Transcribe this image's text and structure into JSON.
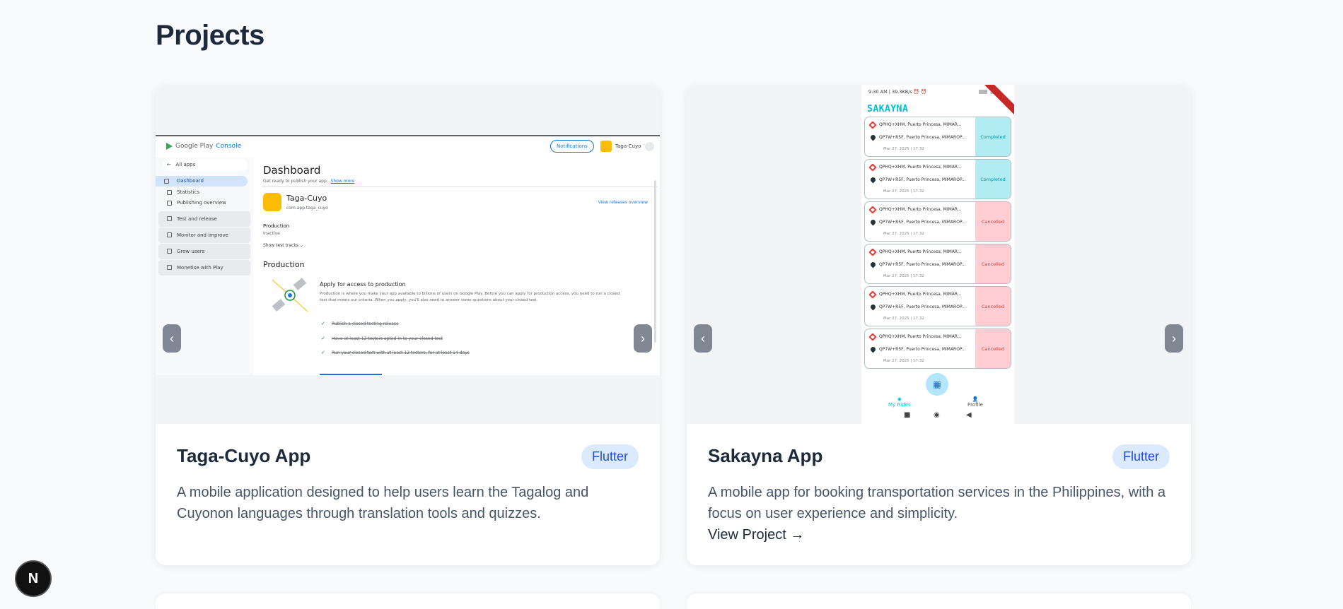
{
  "page": {
    "title": "Projects"
  },
  "projects": [
    {
      "title": "Taga-Cuyo App",
      "tag": "Flutter",
      "description": "A mobile application designed to help users learn the Tagalog and Cuyonon languages through translation tools and quizzes.",
      "prev": "‹",
      "next": "›",
      "screenshot": {
        "brand": "Google Play",
        "brand_suffix": "Console",
        "notifications": "Notifications",
        "user": "Taga-Cuyo",
        "all_apps": "All apps",
        "nav": [
          "Dashboard",
          "Statistics",
          "Publishing overview"
        ],
        "nav_groups": [
          "Test and release",
          "Monitor and improve",
          "Grow users",
          "Monetise with Play"
        ],
        "heading": "Dashboard",
        "subtitle": "Get ready to publish your app.",
        "show_more": "Show more",
        "app_name": "Taga-Cuyo",
        "package": "com.app.taga_cuyo",
        "view_releases": "View releases overview",
        "production_label": "Production",
        "production_status": "Inactive",
        "show_tracks": "Show test tracks",
        "section": "Production",
        "apply_title": "Apply for access to production",
        "apply_text": "Production is where you make your app available to billions of users on Google Play. Before you can apply for production access, you need to run a closed test that meets our criteria. When you apply, you'll also need to answer some questions about your closed test.",
        "checklist": [
          "Publish a closed testing release",
          "Have at least 12 testers opted-in to your closed test",
          "Run your closed test with at least 12 testers, for at least 14 days"
        ]
      }
    },
    {
      "title": "Sakayna App",
      "tag": "Flutter",
      "description": "A mobile app for booking transportation services in the Philippines, with a focus on user experience and simplicity.",
      "link": "View Project →",
      "prev": "‹",
      "next": "›",
      "screenshot": {
        "status_bar": "9:30 AM | 39.3KB/s ⏰ ⏰",
        "logo": "SAKAYNA",
        "rides": [
          {
            "from": "QPHQ+XHM, Puerto Princesa, MIMAR...",
            "to": "QP7W+R5F, Puerto Princesa, MIMAROP...",
            "date": "Mar 27, 2025 | 17:32",
            "status": "Completed"
          },
          {
            "from": "QPHQ+XHM, Puerto Princesa, MIMAR...",
            "to": "QP7W+R5F, Puerto Princesa, MIMAROP...",
            "date": "Mar 27, 2025 | 17:32",
            "status": "Completed"
          },
          {
            "from": "QPHQ+XHM, Puerto Princesa, MIMAR...",
            "to": "QP7W+R5F, Puerto Princesa, MIMAROP...",
            "date": "Mar 27, 2025 | 17:32",
            "status": "Cancelled"
          },
          {
            "from": "QPHQ+XHM, Puerto Princesa, MIMAR...",
            "to": "QP7W+R5F, Puerto Princesa, MIMAROP...",
            "date": "Mar 27, 2025 | 17:32",
            "status": "Cancelled"
          },
          {
            "from": "QPHQ+XHM, Puerto Princesa, MIMAR...",
            "to": "QP7W+R5F, Puerto Princesa, MIMAROP...",
            "date": "Mar 27, 2025 | 17:32",
            "status": "Cancelled"
          },
          {
            "from": "QPHQ+XHM, Puerto Princesa, MIMAR...",
            "to": "QP7W+R5F, Puerto Princesa, MIMAROP...",
            "date": "Mar 27, 2025 | 17:32",
            "status": "Cancelled"
          }
        ],
        "tab_rides": "My Rides",
        "tab_profile": "Profile",
        "sys_buttons": [
          "■",
          "◉",
          "◀"
        ]
      }
    }
  ],
  "dev_badge": "N",
  "colors": {
    "badge_bg": "#dbeafe",
    "badge_text": "#1d4ed8",
    "completed": "#b2ebf2",
    "cancelled": "#ffcdd2",
    "brand_cyan": "#00bcd4"
  }
}
